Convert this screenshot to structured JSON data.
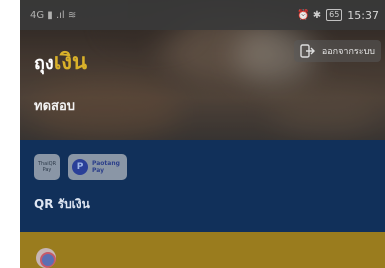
{
  "status_bar": {
    "left_indicators": "4G ▮ .ıl ≋",
    "right_indicators": "⏰ ✱",
    "battery": "65",
    "time": "15:37"
  },
  "header": {
    "logo_part1": "ถุง",
    "logo_part2": "เงิน",
    "logout_label": "ออกจากระบบ",
    "username": "ทดสอบ"
  },
  "qr": {
    "badge_thaiqr": "ThaiQR Pay",
    "badge_paotang_line1": "Paotang",
    "badge_paotang_line2": "Pay",
    "label": "QR รับเงิน"
  },
  "colors": {
    "logo_accent": "#d9b12a",
    "qr_band": "#11305a",
    "yellow_band": "#9a7c1e"
  }
}
